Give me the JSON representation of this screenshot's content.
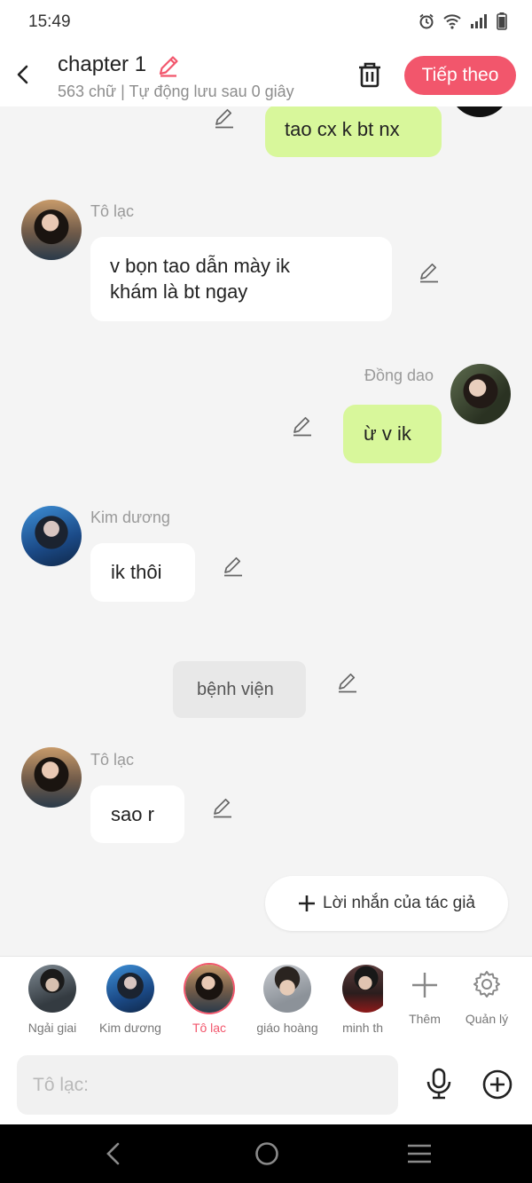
{
  "status_bar": {
    "time": "15:49"
  },
  "header": {
    "title": "chapter 1",
    "subtitle": "563 chữ | Tự động lưu sau 0 giây",
    "next_label": "Tiếp theo"
  },
  "messages": [
    {
      "side": "right",
      "speaker": "",
      "text": "tao cx k bt nx"
    },
    {
      "side": "left",
      "speaker": "Tô lạc",
      "text": "v bọn tao dẫn mày ik\nkhám là bt ngay"
    },
    {
      "side": "right",
      "speaker": "Đồng dao",
      "text": "ừ v ik"
    },
    {
      "side": "left",
      "speaker": "Kim dương",
      "text": "ik thôi"
    },
    {
      "side": "center",
      "speaker": "",
      "text": "bệnh viện"
    },
    {
      "side": "left",
      "speaker": "Tô lạc",
      "text": "sao r"
    }
  ],
  "author_note": {
    "label": "Lời nhắn của tác giả"
  },
  "characters": [
    {
      "name": "Ngải giai",
      "selected": false
    },
    {
      "name": "Kim dương",
      "selected": false
    },
    {
      "name": "Tô lạc",
      "selected": true
    },
    {
      "name": "giáo hoàng",
      "selected": false
    },
    {
      "name": "minh thả",
      "selected": false
    }
  ],
  "tools": {
    "add_label": "Thêm",
    "manage_label": "Quản lý"
  },
  "composer": {
    "placeholder": "Tô lạc:"
  },
  "colors": {
    "accent": "#f2566c",
    "green_bubble": "#d8f79b",
    "background": "#f4f4f4"
  }
}
